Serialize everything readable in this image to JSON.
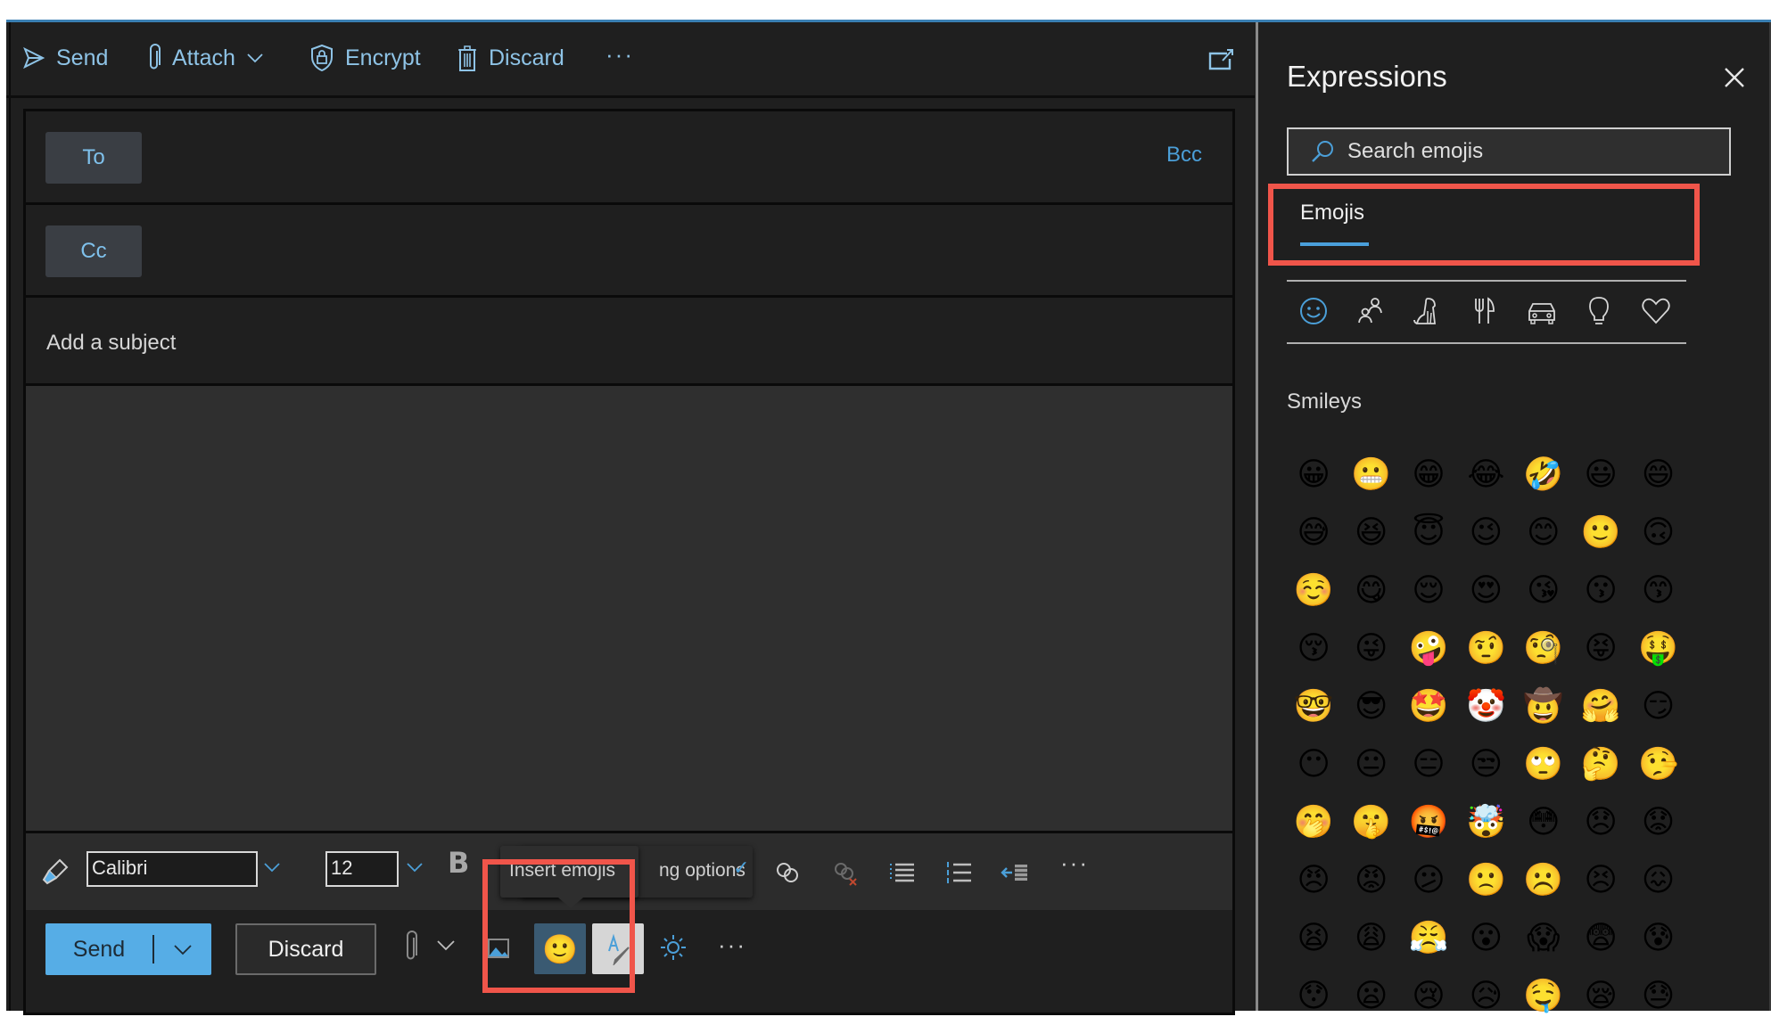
{
  "toolbar": {
    "send_label": "Send",
    "attach_label": "Attach",
    "encrypt_label": "Encrypt",
    "discard_label": "Discard",
    "more_label": "···"
  },
  "compose": {
    "to_label": "To",
    "cc_label": "Cc",
    "bcc_label": "Bcc",
    "subject_placeholder": "Add a subject",
    "subject_value": ""
  },
  "format_bar": {
    "font_name": "Calibri",
    "font_size": "12",
    "bold_label": "B",
    "more_label": "···",
    "check_glyph": "✓"
  },
  "tooltips": {
    "insert_emojis": "Insert emojis",
    "formatting_options_partial": "ng options"
  },
  "send_bar": {
    "send_label": "Send",
    "discard_label": "Discard",
    "more_label": "···",
    "emoji_glyph": "🙂"
  },
  "colors": {
    "accent": "#4a9fdb",
    "send_button": "#56ade6",
    "highlight": "#f0554a",
    "emoji_button_active": "#3a5a72"
  },
  "expressions": {
    "title": "Expressions",
    "search_placeholder": "Search emojis",
    "active_tab": "Emojis",
    "categories": [
      "smileys",
      "people",
      "animals",
      "food",
      "travel",
      "objects",
      "symbols"
    ],
    "active_category": "smileys",
    "section_label": "Smileys",
    "emojis": [
      "😀",
      "😬",
      "😁",
      "😂",
      "🤣",
      "😃",
      "😄",
      "😅",
      "😆",
      "😇",
      "😉",
      "😊",
      "🙂",
      "🙃",
      "☺️",
      "😋",
      "😌",
      "😍",
      "😘",
      "😗",
      "😙",
      "😚",
      "😜",
      "🤪",
      "🤨",
      "🧐",
      "😝",
      "🤑",
      "🤓",
      "😎",
      "🤩",
      "🤡",
      "🤠",
      "🤗",
      "😏",
      "😶",
      "😐",
      "😑",
      "😒",
      "🙄",
      "🤔",
      "🤥",
      "🤭",
      "🤫",
      "🤬",
      "🤯",
      "😳",
      "😞",
      "😟",
      "😠",
      "😡",
      "😕",
      "🙁",
      "☹️",
      "😣",
      "😖",
      "😫",
      "😩",
      "😤",
      "😮",
      "😱",
      "😨",
      "😰",
      "😯",
      "😦",
      "😢",
      "😥",
      "🤤",
      "😪",
      "😓"
    ]
  }
}
